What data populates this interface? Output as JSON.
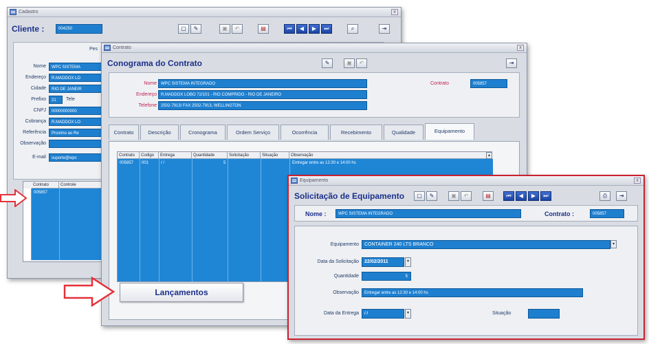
{
  "cadastro": {
    "title": "Cadastro",
    "heading": "Cliente :",
    "client_code": "004250",
    "partial_label": "Pes",
    "fields": [
      {
        "label": "Nome",
        "value": "WPC SISTEMA"
      },
      {
        "label": "Endereço",
        "value": "R.MADDOX LO"
      },
      {
        "label": "Cidade",
        "value": "RIO DE JANEIR"
      },
      {
        "label": "Prefixo",
        "value": "21"
      },
      {
        "label": "CNPJ",
        "value": "00000000000"
      },
      {
        "label": "Cobrança",
        "value": "R.MADDOX LO"
      },
      {
        "label": "Referência",
        "value": "Proximo ao Re"
      },
      {
        "label": "Observação",
        "value": ""
      },
      {
        "label": "E-mail",
        "value": "suporte@wpc"
      }
    ],
    "partial_tele_label": "Tele",
    "grid_headers": [
      "Contrato",
      "Controle"
    ],
    "grid_row": [
      "005857",
      ""
    ]
  },
  "contrato": {
    "title": "Contrato",
    "heading": "Conograma do Contrato",
    "contract_label": "Contrato",
    "contract_value": "005857",
    "nome_label": "Nome",
    "nome_value": "WPC SISTEMA INTEGRADO",
    "endereco_label": "Endereço",
    "endereco_value": "R.MADDOX LOBO 72/101 - RIO COMPRIDO - RIO DE JANEIRO",
    "telefone_label": "Telefone",
    "telefone_value": "2502-7913/ FAX 2502-7913, WELLINGTON",
    "tabs": [
      "Contrato",
      "Descrição",
      "Cronograma",
      "Ordem Serviço",
      "Ocorrência",
      "Recebimento",
      "Qualidade",
      "Equipamento"
    ],
    "grid_headers": [
      "Contrato",
      "Codigo",
      "Entrega",
      "Quantidade",
      "Solicitação",
      "Situação",
      "Observação"
    ],
    "grid_row": [
      "005857",
      "001",
      "/ /",
      "5",
      "",
      "",
      "Entregar entre as 12:30 e 14:00 hs"
    ],
    "lancamentos_label": "Lançamentos"
  },
  "equipamento": {
    "title": "Equipamento",
    "heading": "Solicitação de Equipamento",
    "nome_label": "Nome :",
    "nome_value": "WPC SISTEMA INTEGRADO",
    "contrato_label": "Contrato :",
    "contrato_value": "005857",
    "equip_label": "Equipamento",
    "equip_value": "CONTAINER 240 LTS BRANCO",
    "data_sol_label": "Data da Solicitação",
    "data_sol_value": "22/02/2011",
    "quantidade_label": "Quantidade",
    "quantidade_value": "5",
    "observacao_label": "Observação",
    "observacao_value": "Entregar entre as 12:30 e 14:00 hs",
    "data_entrega_label": "Data da Entrega",
    "data_entrega_value": "/ /",
    "situacao_label": "Situação",
    "situacao_value": ""
  },
  "colors": {
    "field_blue": "#1e7fcf",
    "heading_navy": "#1c2f8a",
    "highlight_red": "#c8202f",
    "arrow_red": "#e53039"
  },
  "icons": [
    "new-record-icon",
    "edit-icon",
    "save-icon",
    "undo-icon",
    "delete-icon",
    "first-record-icon",
    "prev-record-icon",
    "next-record-icon",
    "last-record-icon",
    "search-icon",
    "print-icon",
    "exit-icon",
    "dropdown-arrow-icon",
    "arrow-pointer-icon"
  ]
}
